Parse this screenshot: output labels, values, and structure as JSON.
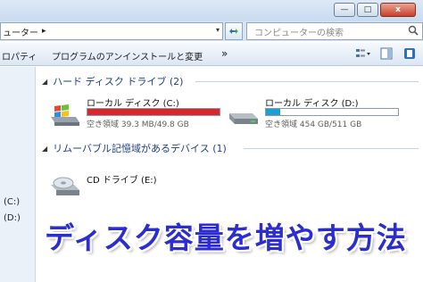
{
  "window": {
    "minimize_glyph": "—",
    "maximize_glyph": "□",
    "close_glyph": "x"
  },
  "address": {
    "path": "ューター",
    "separator": "▸",
    "dropdown": "▾",
    "refresh_icon": "refresh-icon",
    "search_placeholder": "コンピューターの検索",
    "search_icon": "search-icon"
  },
  "toolbar": {
    "properties": "ロパティ",
    "uninstall": "プログラムのアンインストールと変更",
    "more": "»",
    "view_icon": "view-options-icon",
    "preview_icon": "preview-pane-icon",
    "help_icon": "help-icon"
  },
  "nav": {
    "items": [
      "(C:)",
      "(D:)"
    ]
  },
  "groups": [
    {
      "title": "ハード ディスク ドライブ (2)",
      "drives": [
        {
          "name": "ローカル ディスク (C:)",
          "info": "空き領域 39.3 MB/49.8 GB",
          "used_fraction": 0.999,
          "bar_color": "#d9262d",
          "icon": "windows-hard-drive-icon"
        },
        {
          "name": "ローカル ディスク (D:)",
          "info": "空き領域 454 GB/511 GB",
          "used_fraction": 0.11,
          "bar_color": "#1c9fd6",
          "icon": "hard-drive-icon"
        }
      ]
    },
    {
      "title": "リムーバブル記憶域があるデバイス (1)",
      "drives": [
        {
          "name": "CD ドライブ (E:)",
          "icon": "cd-drive-icon"
        }
      ]
    }
  ],
  "caption": "ディスク容量を増やす方法",
  "colors": {
    "caption": "#2b2dd0",
    "group_header": "#1e3f8a"
  }
}
